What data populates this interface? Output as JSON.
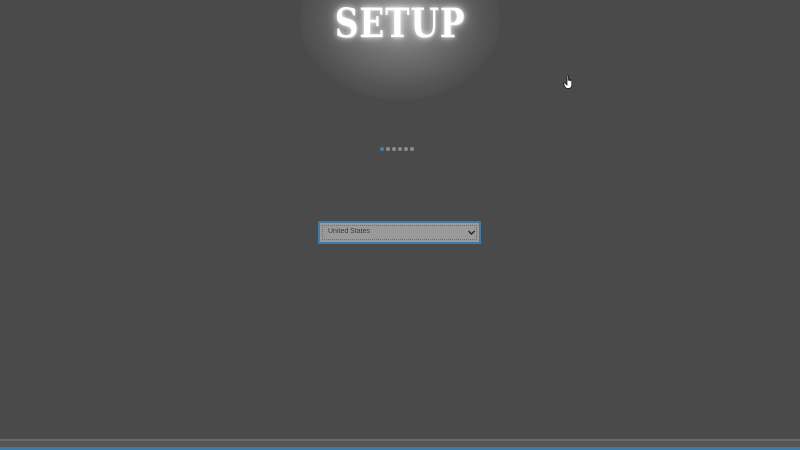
{
  "header": {
    "title": "SETUP"
  },
  "progress": {
    "total_steps": 6,
    "current_step": 1
  },
  "country_select": {
    "selected_value": "United States",
    "icon": "chevron-down-icon"
  },
  "cursor": {
    "icon": "hand-pointer-icon"
  },
  "colors": {
    "background": "#4a4a4a",
    "accent": "#3f7ba8",
    "active_dot": "#4a7fa8",
    "inactive_dot": "#8a8a8a"
  }
}
